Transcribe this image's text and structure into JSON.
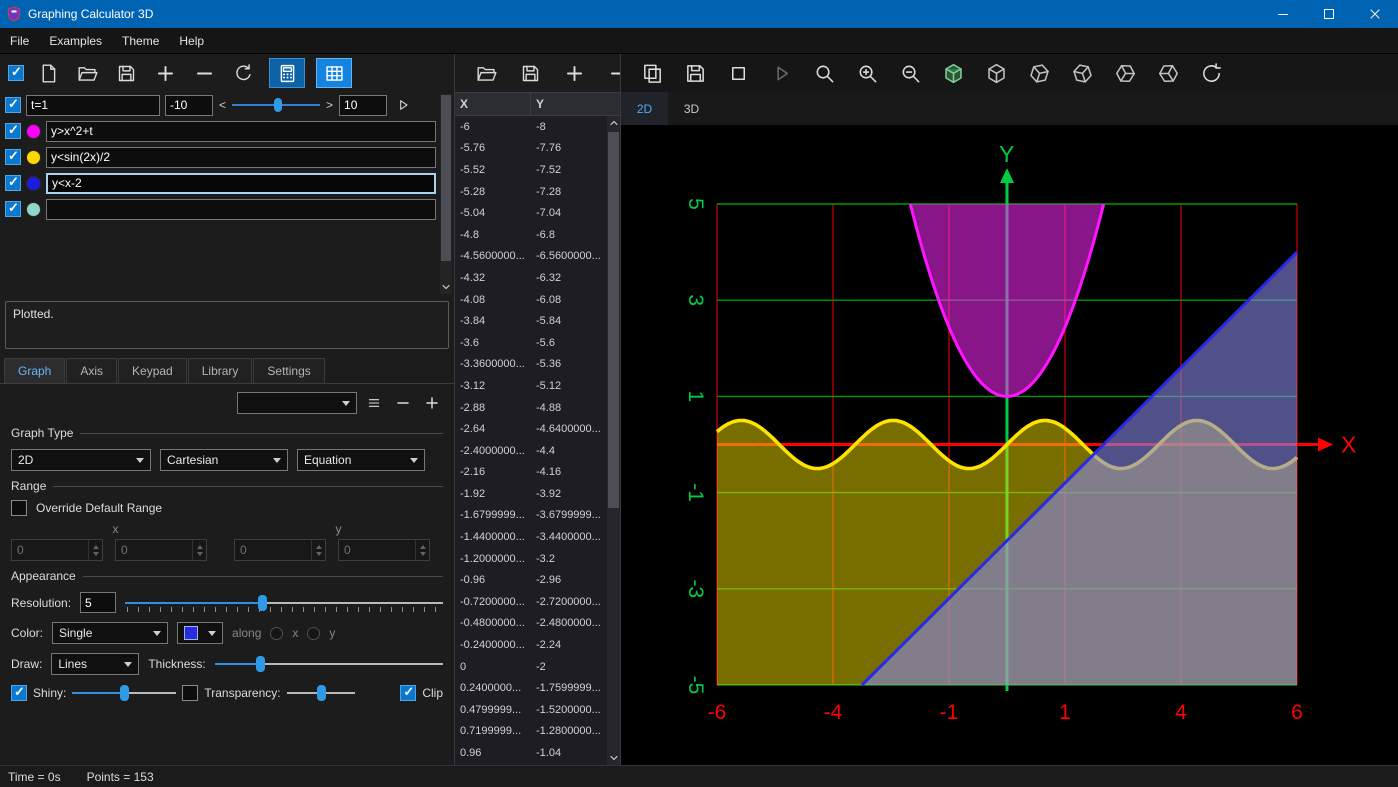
{
  "window": {
    "title": "Graphing Calculator 3D"
  },
  "menubar": {
    "items": [
      "File",
      "Examples",
      "Theme",
      "Help"
    ]
  },
  "equations": {
    "param": {
      "expr": "t=1",
      "min": "-10",
      "max": "10",
      "dec": "<",
      "inc": ">"
    },
    "rows": [
      {
        "color": "#ff00ff",
        "text": "y>x^2+t",
        "focused": false
      },
      {
        "color": "#ffd800",
        "text": "y<sin(2x)/2",
        "focused": false
      },
      {
        "color": "#1c1ce0",
        "text": "y<x-2",
        "focused": true
      },
      {
        "color": "#8fd8c8",
        "text": "",
        "focused": false
      }
    ]
  },
  "message": "Plotted.",
  "panel_tabs": {
    "items": [
      "Graph",
      "Axis",
      "Keypad",
      "Library",
      "Settings"
    ],
    "active": "Graph"
  },
  "graph_type": {
    "title": "Graph Type",
    "selects": [
      "2D",
      "Cartesian",
      "Equation"
    ]
  },
  "range": {
    "title": "Range",
    "override_label": "Override Default Range",
    "x_label": "x",
    "y_label": "y",
    "values": [
      "0",
      "0",
      "0",
      "0"
    ]
  },
  "appearance": {
    "title": "Appearance",
    "resolution_label": "Resolution:",
    "resolution_value": "5",
    "color_label": "Color:",
    "color_value": "Single",
    "along_label": "along",
    "along_x": "x",
    "along_y": "y",
    "draw_label": "Draw:",
    "draw_value": "Lines",
    "thickness_label": "Thickness:",
    "shiny_label": "Shiny:",
    "transparency_label": "Transparency:",
    "clip_label": "Clip"
  },
  "table": {
    "headers": [
      "X",
      "Y"
    ],
    "rows": [
      [
        "-6",
        "-8"
      ],
      [
        "-5.76",
        "-7.76"
      ],
      [
        "-5.52",
        "-7.52"
      ],
      [
        "-5.28",
        "-7.28"
      ],
      [
        "-5.04",
        "-7.04"
      ],
      [
        "-4.8",
        "-6.8"
      ],
      [
        "-4.5600000...",
        "-6.5600000..."
      ],
      [
        "-4.32",
        "-6.32"
      ],
      [
        "-4.08",
        "-6.08"
      ],
      [
        "-3.84",
        "-5.84"
      ],
      [
        "-3.6",
        "-5.6"
      ],
      [
        "-3.3600000...",
        "-5.36"
      ],
      [
        "-3.12",
        "-5.12"
      ],
      [
        "-2.88",
        "-4.88"
      ],
      [
        "-2.64",
        "-4.6400000..."
      ],
      [
        "-2.4000000...",
        "-4.4"
      ],
      [
        "-2.16",
        "-4.16"
      ],
      [
        "-1.92",
        "-3.92"
      ],
      [
        "-1.6799999...",
        "-3.6799999..."
      ],
      [
        "-1.4400000...",
        "-3.4400000..."
      ],
      [
        "-1.2000000...",
        "-3.2"
      ],
      [
        "-0.96",
        "-2.96"
      ],
      [
        "-0.7200000...",
        "-2.7200000..."
      ],
      [
        "-0.4800000...",
        "-2.4800000..."
      ],
      [
        "-0.2400000...",
        "-2.24"
      ],
      [
        "0",
        "-2"
      ],
      [
        "0.2400000...",
        "-1.7599999..."
      ],
      [
        "0.4799999...",
        "-1.5200000..."
      ],
      [
        "0.7199999...",
        "-1.2800000..."
      ],
      [
        "0.96",
        "-1.04"
      ]
    ]
  },
  "view_tabs": {
    "items": [
      "2D",
      "3D"
    ],
    "active": "2D"
  },
  "statusbar": {
    "time": "Time = 0s",
    "points": "Points = 153"
  },
  "chart_data": {
    "type": "line",
    "title": "",
    "x_range": [
      -6,
      6
    ],
    "y_range": [
      -5,
      5
    ],
    "x_ticks": [
      -6,
      -3.6,
      -1.2,
      1.2,
      3.6,
      6
    ],
    "x_tick_labels": [
      "-6",
      "-4",
      "-1",
      "1",
      "4",
      "6"
    ],
    "y_ticks": [
      5,
      3,
      1,
      -1,
      -3,
      -5
    ],
    "y_tick_labels": [
      "5",
      "3",
      "1",
      "-1",
      "-3",
      "-5"
    ],
    "x_axis_label": "X",
    "y_axis_label": "Y",
    "grid": true,
    "colors": {
      "bg": "#000000",
      "grid_v": "#b30000",
      "grid_h": "#009900",
      "axis_x": "#ff0000",
      "axis_y": "#00cc44"
    },
    "series": [
      {
        "name": "y>x^2+t",
        "fn": "parabola",
        "a": 1,
        "c": 1,
        "region": "above",
        "stroke": "#ff14ff",
        "fill": "rgba(250,40,250,0.55)",
        "width": 3,
        "draw_order": 3
      },
      {
        "name": "y<sin(2x)/2",
        "fn": "sine",
        "amp": 0.5,
        "freq": 2,
        "region": "below",
        "stroke": "#ffe300",
        "fill": "rgba(240,220,0,0.5)",
        "width": 3.6,
        "draw_order": 1
      },
      {
        "name": "y<x-2",
        "fn": "linear",
        "m": 1,
        "b": -2,
        "region": "below",
        "stroke": "#2929e8",
        "fill": "rgba(135,135,230,0.6)",
        "width": 3,
        "draw_order": 2
      }
    ]
  }
}
